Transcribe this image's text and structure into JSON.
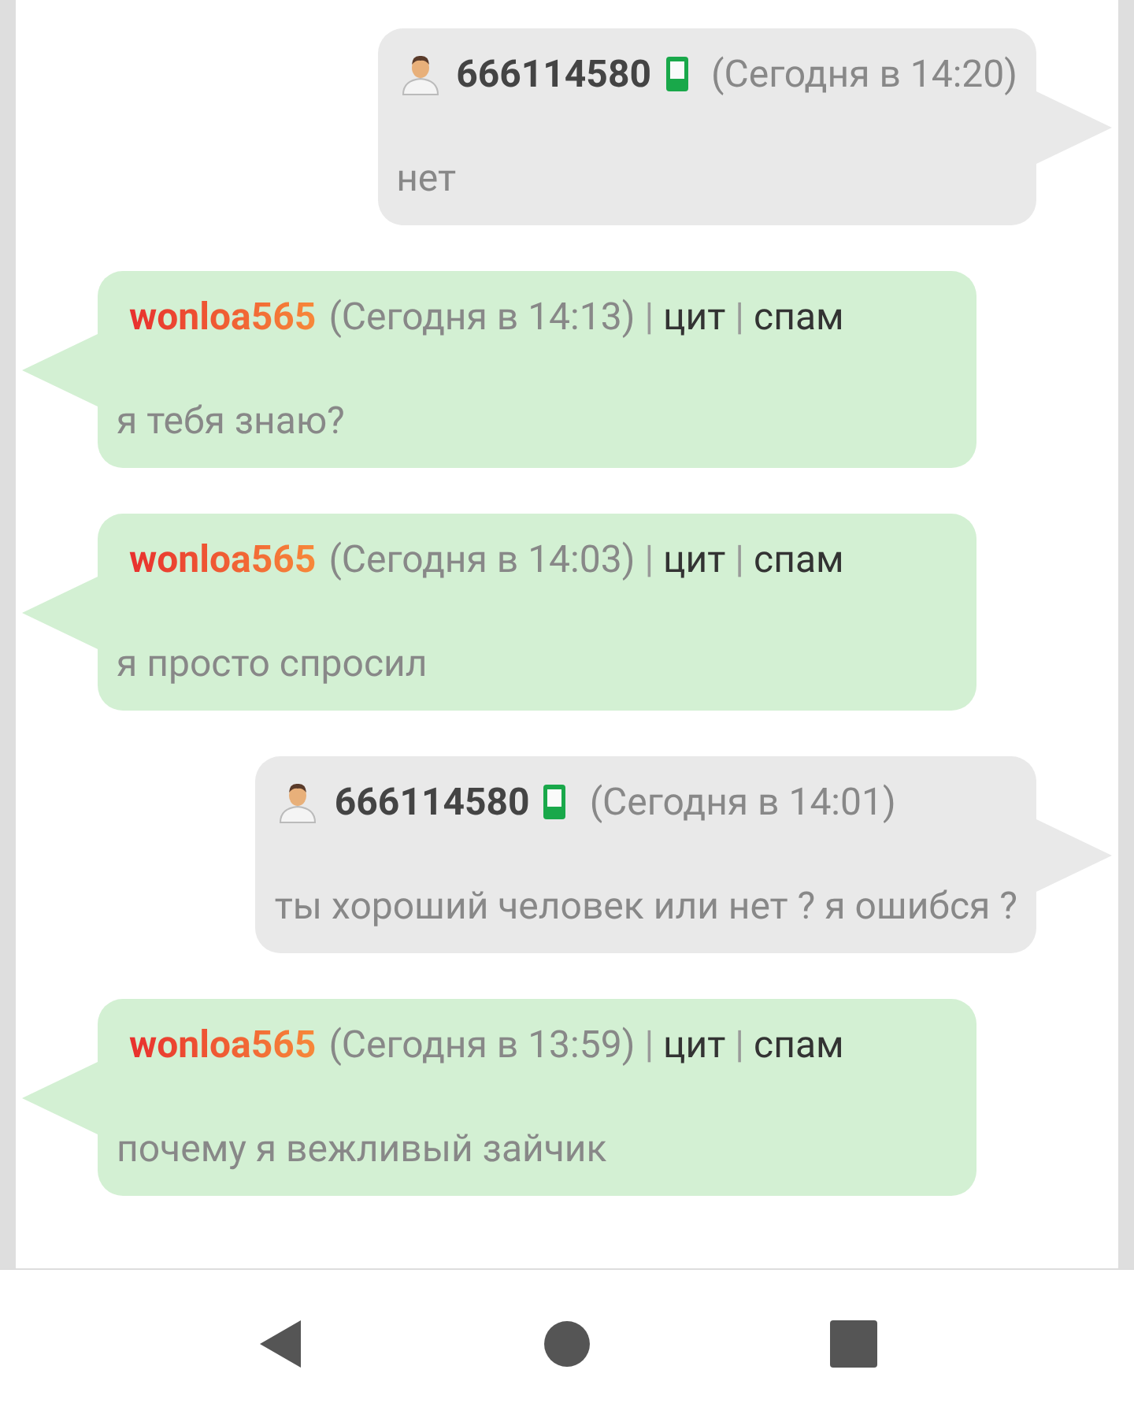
{
  "messages": [
    {
      "kind": "outgoing",
      "author": "666114580",
      "time": "(Сегодня в 14:20)",
      "text": "нет"
    },
    {
      "kind": "incoming",
      "author": "wonloa565",
      "time": "(Сегодня в 14:13)",
      "separator": "|",
      "actions": [
        "цит",
        "спам"
      ],
      "text": "я тебя знаю?"
    },
    {
      "kind": "incoming",
      "author": "wonloa565",
      "time": "(Сегодня в 14:03)",
      "separator": "|",
      "actions": [
        "цит",
        "спам"
      ],
      "text": "я просто спросил"
    },
    {
      "kind": "outgoing",
      "author": "666114580",
      "time": "(Сегодня в 14:01)",
      "text": "ты хороший человек или нет ? я ошибся ?"
    },
    {
      "kind": "incoming",
      "author": "wonloa565",
      "time": "(Сегодня в 13:59)",
      "separator": "|",
      "actions": [
        "цит",
        "спам"
      ],
      "text": "почему я вежливый зайчик"
    }
  ]
}
